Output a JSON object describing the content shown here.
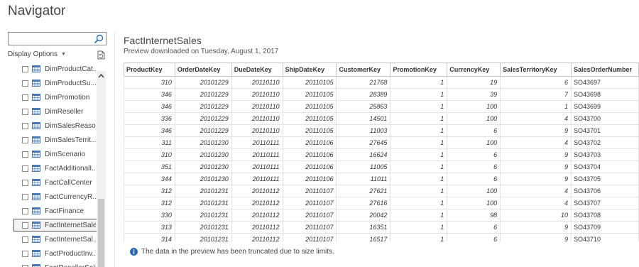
{
  "window": {
    "title": "Navigator"
  },
  "search": {
    "placeholder": "",
    "value": ""
  },
  "toolbar": {
    "display_options_label": "Display Options"
  },
  "tree": {
    "items": [
      {
        "label": "DimProductCat...",
        "selected": false
      },
      {
        "label": "DimProductSu...",
        "selected": false
      },
      {
        "label": "DimPromotion",
        "selected": false
      },
      {
        "label": "DimReseller",
        "selected": false
      },
      {
        "label": "DimSalesReason",
        "selected": false
      },
      {
        "label": "DimSalesTerrit...",
        "selected": false
      },
      {
        "label": "DimScenario",
        "selected": false
      },
      {
        "label": "FactAdditionalI...",
        "selected": false
      },
      {
        "label": "FactCallCenter",
        "selected": false
      },
      {
        "label": "FactCurrencyR...",
        "selected": false
      },
      {
        "label": "FactFinance",
        "selected": false
      },
      {
        "label": "FactInternetSales",
        "selected": true
      },
      {
        "label": "FactInternetSal...",
        "selected": false
      },
      {
        "label": "FactProductInv...",
        "selected": false
      },
      {
        "label": "FactResellerSales",
        "selected": false
      }
    ]
  },
  "preview": {
    "title": "FactInternetSales",
    "subtitle": "Preview downloaded on Tuesday, August 1, 2017",
    "columns": [
      "ProductKey",
      "OrderDateKey",
      "DueDateKey",
      "ShipDateKey",
      "CustomerKey",
      "PromotionKey",
      "CurrencyKey",
      "SalesTerritoryKey",
      "SalesOrderNumber"
    ],
    "rows": [
      [
        "310",
        "20101229",
        "20110110",
        "20110105",
        "21768",
        "1",
        "19",
        "6",
        "SO43697"
      ],
      [
        "346",
        "20101229",
        "20110110",
        "20110105",
        "28389",
        "1",
        "39",
        "7",
        "SO43698"
      ],
      [
        "346",
        "20101229",
        "20110110",
        "20110105",
        "25863",
        "1",
        "100",
        "1",
        "SO43699"
      ],
      [
        "336",
        "20101229",
        "20110110",
        "20110105",
        "14501",
        "1",
        "100",
        "4",
        "SO43700"
      ],
      [
        "346",
        "20101229",
        "20110110",
        "20110105",
        "11003",
        "1",
        "6",
        "9",
        "SO43701"
      ],
      [
        "311",
        "20101230",
        "20110111",
        "20110106",
        "27645",
        "1",
        "100",
        "4",
        "SO43702"
      ],
      [
        "310",
        "20101230",
        "20110111",
        "20110106",
        "16624",
        "1",
        "6",
        "9",
        "SO43703"
      ],
      [
        "351",
        "20101230",
        "20110111",
        "20110106",
        "11005",
        "1",
        "6",
        "9",
        "SO43704"
      ],
      [
        "344",
        "20101230",
        "20110111",
        "20110106",
        "11011",
        "1",
        "6",
        "9",
        "SO43705"
      ],
      [
        "312",
        "20101231",
        "20110112",
        "20110107",
        "27621",
        "1",
        "100",
        "4",
        "SO43706"
      ],
      [
        "312",
        "20101231",
        "20110112",
        "20110107",
        "27616",
        "1",
        "100",
        "4",
        "SO43707"
      ],
      [
        "330",
        "20101231",
        "20110112",
        "20110107",
        "20042",
        "1",
        "98",
        "10",
        "SO43708"
      ],
      [
        "313",
        "20101231",
        "20110112",
        "20110107",
        "16351",
        "1",
        "6",
        "9",
        "SO43709"
      ],
      [
        "314",
        "20101231",
        "20110112",
        "20110107",
        "16517",
        "1",
        "6",
        "9",
        "SO43710"
      ]
    ],
    "truncated_message": "The data in the preview has been truncated due to size limits."
  },
  "icons": {
    "search": "search-icon",
    "refresh": "refresh-icon",
    "table": "table-icon",
    "info": "info-icon"
  },
  "colors": {
    "info_blue": "#2b6cb0",
    "table_icon_blue": "#4a7ab5"
  }
}
